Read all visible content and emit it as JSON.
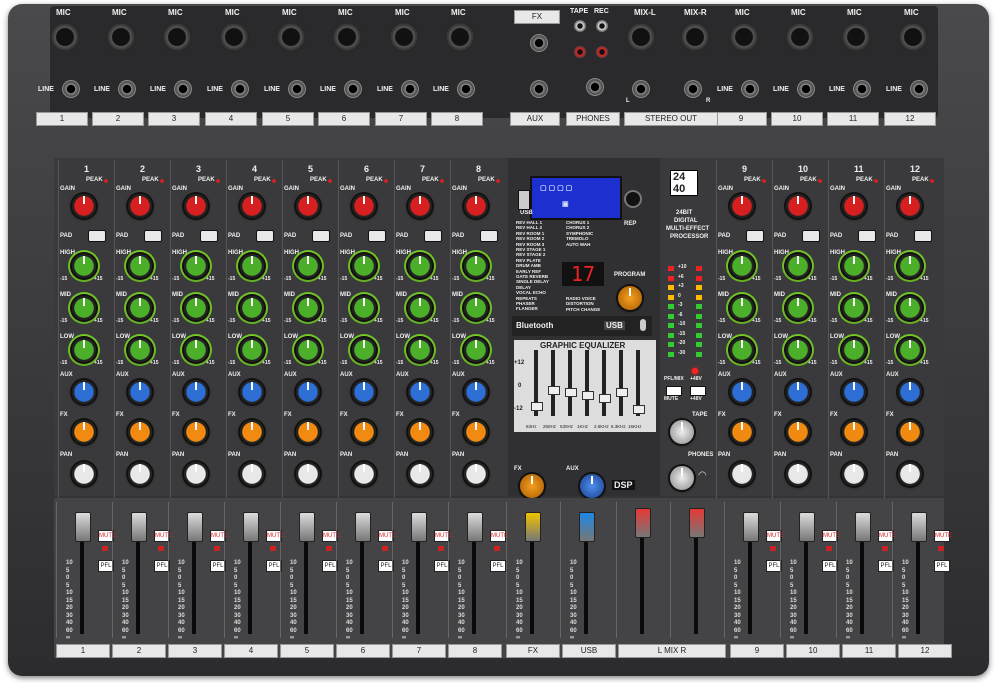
{
  "input_channels": {
    "numbers": [
      "1",
      "2",
      "3",
      "4",
      "5",
      "6",
      "7",
      "8",
      "9",
      "10",
      "11",
      "12"
    ],
    "mic_label": "MIC",
    "line_label": "LINE",
    "gain_label": "GAIN",
    "peak_label": "PEAK",
    "pad_label": "PAD",
    "high_label": "HIGH",
    "mid_label": "MID",
    "low_label": "LOW",
    "aux_label": "AUX",
    "fx_label": "FX",
    "pan_label": "PAN",
    "mute_label": "MUTE",
    "pfl_label": "PFL",
    "eq_range_low": "-15",
    "eq_range_high": "+15"
  },
  "rear_panel": {
    "fx_label": "FX",
    "aux_label": "AUX",
    "tape_label": "TAPE",
    "rec_label": "REC",
    "phones_label": "PHONES",
    "mix_l_label": "MIX-L",
    "mix_r_label": "MIX-R",
    "stereo_out_label": "STEREO OUT",
    "l_label": "L",
    "r_label": "R"
  },
  "fx_processor": {
    "badge_top": "24",
    "badge_bottom": "40",
    "title_1": "24BIT",
    "title_2": "DIGITAL",
    "title_3": "MULTI-EFFECT",
    "title_4": "PROCESSOR",
    "usb_label": "USB",
    "rep_label": "REP",
    "program_label": "PROGRAM",
    "program_display": "17",
    "bluetooth_label": "Bluetooth",
    "usb_badge": "USB",
    "effects_left": [
      "REV HALL 1",
      "REV HALL 2",
      "REV ROOM 1",
      "REV ROOM 2",
      "REV ROOM 3",
      "REV STAGE 1",
      "REV STAGE 2",
      "REV PLATE",
      "DRUM AMB",
      "EARLY REF",
      "GATE REVERB",
      "SINGLE DELAY",
      "DELAY",
      "VOCAL ECHO",
      "REPEATS",
      "PHASER",
      "FLANGER"
    ],
    "effects_right": [
      "CHORUS 1",
      "CHORUS 2",
      "SYMPHONIC",
      "TREMOLO",
      "AUTO WAH",
      "RADIO VOICE",
      "DISTORTION",
      "PITCH CHANGE"
    ]
  },
  "graphic_eq": {
    "title": "GRAPHIC EQUALIZER",
    "scale_top": "+12",
    "scale_mid": "0",
    "scale_bottom": "-12",
    "bands": [
      "63Hz",
      "250Hz",
      "630Hz",
      "1KHz",
      "2.5KHz",
      "6.3KHz",
      "15KHz"
    ],
    "levels_db": [
      -8,
      -2,
      -3,
      -4,
      -5,
      -3,
      -9
    ]
  },
  "master": {
    "fx_label": "FX",
    "aux_label": "AUX",
    "dsp_label": "DSP",
    "tape_label": "TAPE",
    "phones_label": "PHONES",
    "mute_label": "MUTE",
    "plus48v_label": "+48V",
    "pfl_mix_label": "PFL/MIX",
    "meter_labels": [
      "+10",
      "+6",
      "+3",
      "0",
      "-3",
      "-6",
      "-10",
      "-15",
      "-20",
      "-30"
    ]
  },
  "faders": {
    "channel_labels": [
      "1",
      "2",
      "3",
      "4",
      "5",
      "6",
      "7",
      "8",
      "FX",
      "USB",
      "L  MIX  R",
      "9",
      "10",
      "11",
      "12"
    ],
    "scale": [
      "10",
      "5",
      "0",
      "5",
      "10",
      "15",
      "20",
      "30",
      "40",
      "60",
      "∞"
    ],
    "cap_colors": {
      "channel": "#dcdcdc",
      "fx": "#f2c200",
      "usb": "#1e88e5",
      "mix": "#e53935"
    }
  },
  "colors": {
    "gain": "#d62020",
    "eq": "#4caf2a",
    "aux": "#2e6fd6",
    "fx": "#f08a10",
    "pan": "#e8e8e8"
  }
}
